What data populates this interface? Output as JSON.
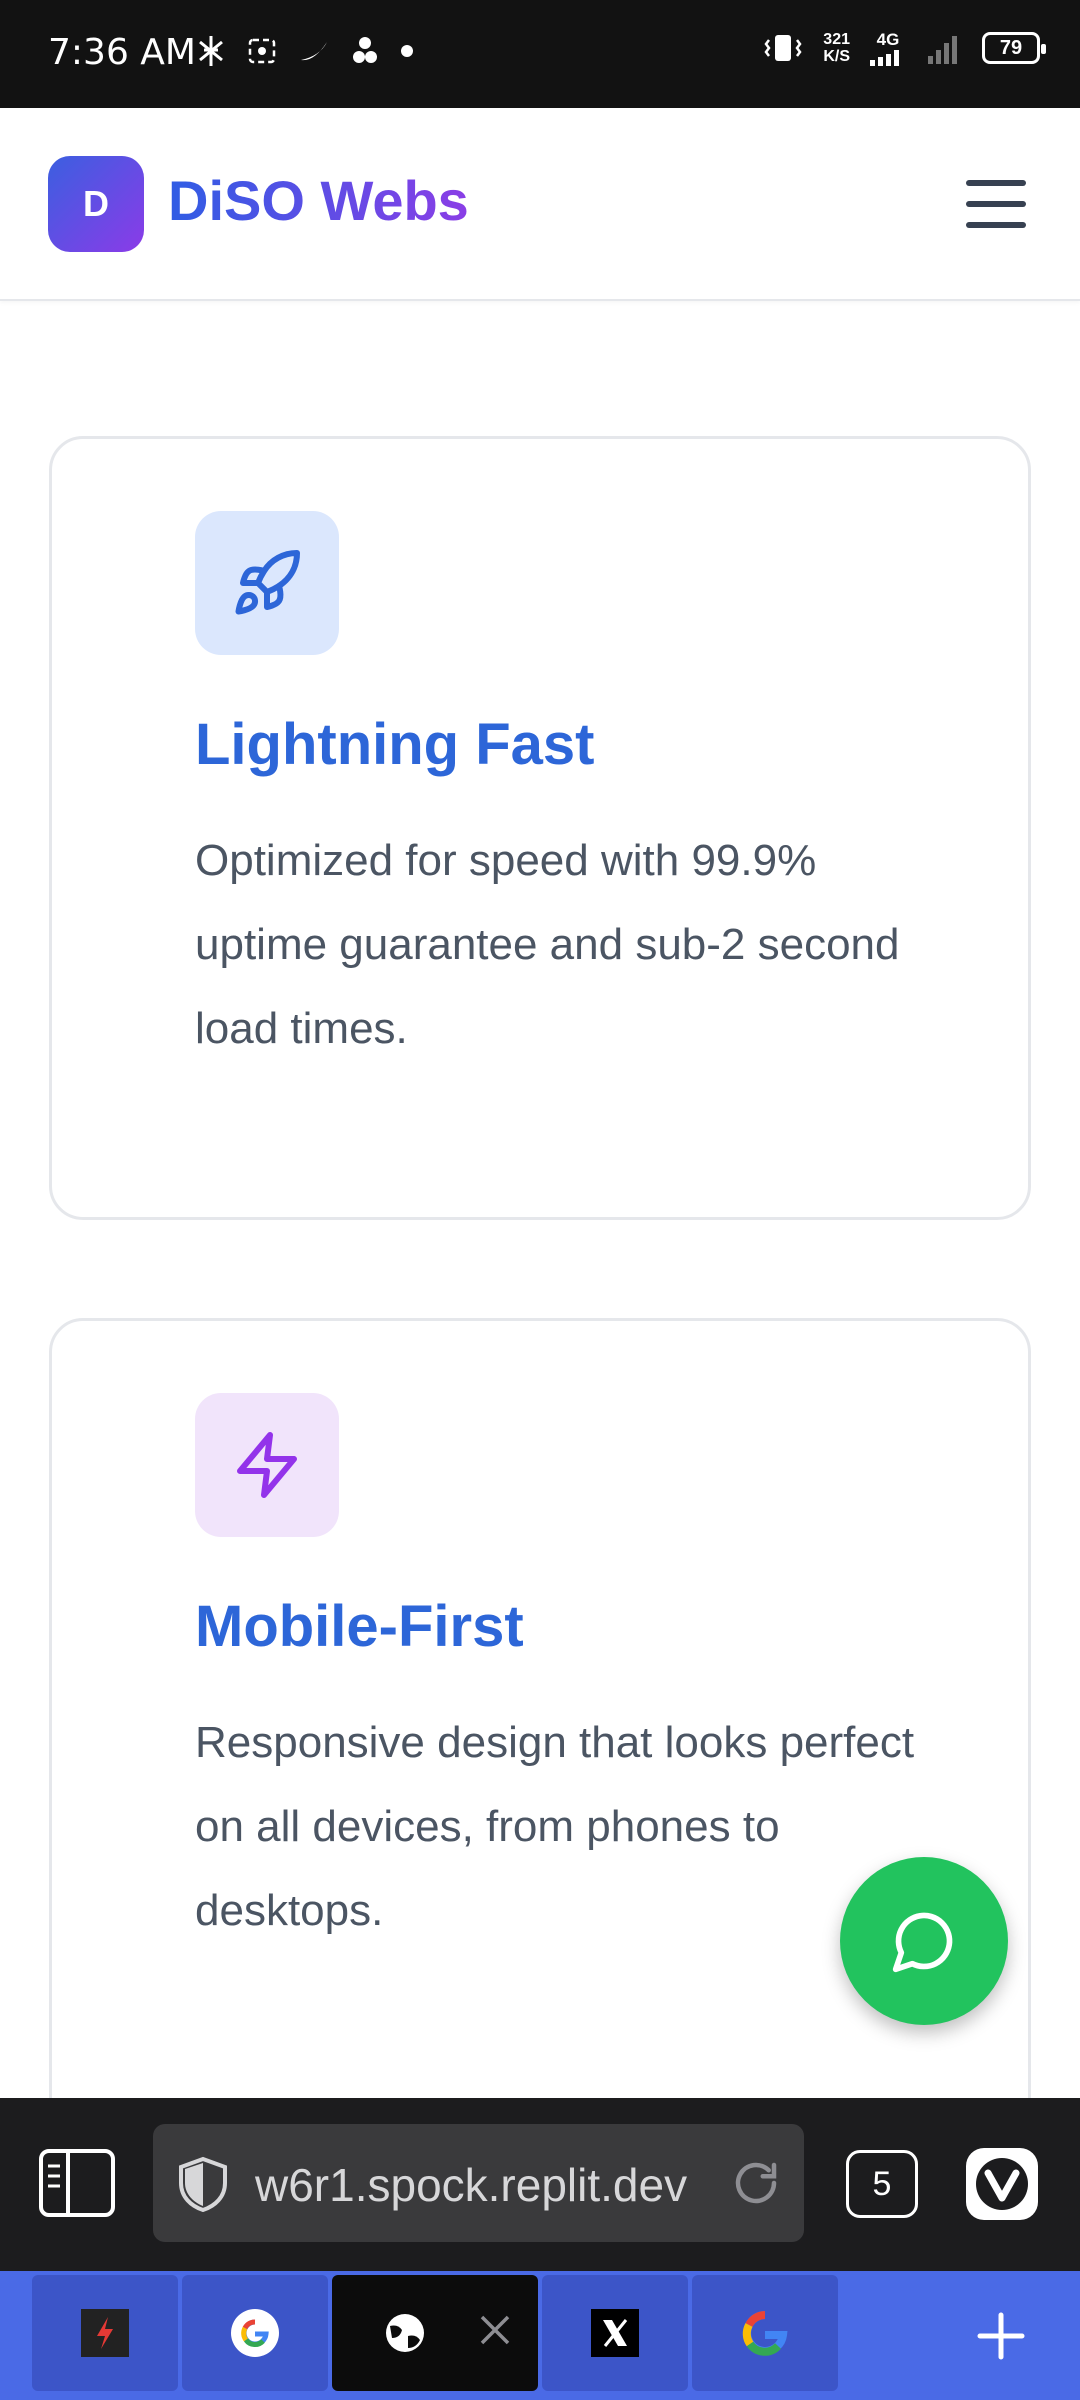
{
  "status_bar": {
    "time": "7:36 AM",
    "net_speed_value": "321",
    "net_speed_unit": "K/S",
    "network_type": "4G",
    "battery": "79"
  },
  "header": {
    "logo_letter": "D",
    "brand_name": "DiSO Webs"
  },
  "features": [
    {
      "icon": "rocket-icon",
      "title": "Lightning Fast",
      "description": "Optimized for speed with 99.9% uptime guarantee and sub-2 second load times."
    },
    {
      "icon": "zap-icon",
      "title": "Mobile-First",
      "description": "Responsive design that looks perfect on all devices, from phones to desktops."
    }
  ],
  "browser": {
    "url": "w6r1.spock.replit.dev",
    "tab_count": "5"
  },
  "colors": {
    "brand_gradient_start": "#3b5fe0",
    "brand_gradient_end": "#8b3be8",
    "card_title": "#2d66d8",
    "fab_green": "#22c35e",
    "tabbar_blue": "#4a6ae6"
  }
}
